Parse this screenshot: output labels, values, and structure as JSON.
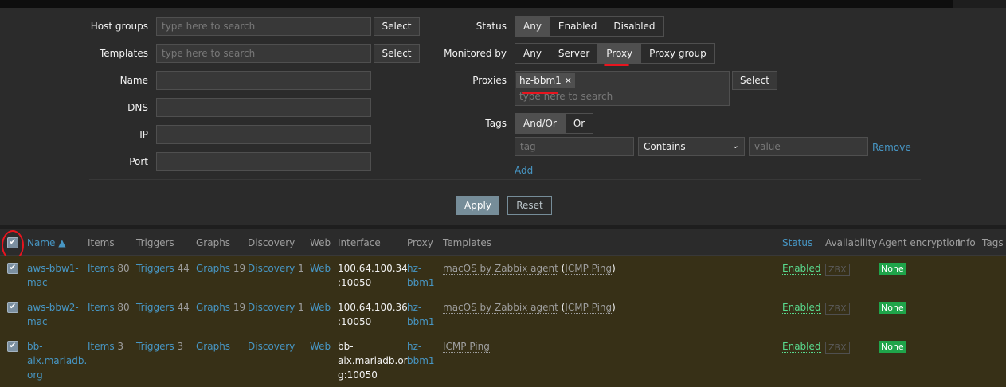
{
  "filter": {
    "host_groups": {
      "label": "Host groups",
      "placeholder": "type here to search",
      "button": "Select"
    },
    "templates": {
      "label": "Templates",
      "placeholder": "type here to search",
      "button": "Select"
    },
    "name": {
      "label": "Name",
      "value": ""
    },
    "dns": {
      "label": "DNS",
      "value": ""
    },
    "ip": {
      "label": "IP",
      "value": ""
    },
    "port": {
      "label": "Port",
      "value": ""
    },
    "status": {
      "label": "Status",
      "options": [
        "Any",
        "Enabled",
        "Disabled"
      ],
      "selected": "Any"
    },
    "monitored_by": {
      "label": "Monitored by",
      "options": [
        "Any",
        "Server",
        "Proxy",
        "Proxy group"
      ],
      "selected": "Proxy"
    },
    "proxies": {
      "label": "Proxies",
      "chip": "hz-bbm1",
      "chip_remove": "✕",
      "placeholder": "type here to search",
      "button": "Select"
    },
    "tags": {
      "label": "Tags",
      "options": [
        "And/Or",
        "Or"
      ],
      "selected": "And/Or",
      "tag_placeholder": "tag",
      "operator": "Contains",
      "value_placeholder": "value",
      "remove": "Remove",
      "add": "Add"
    },
    "apply": "Apply",
    "reset": "Reset"
  },
  "table": {
    "headers": {
      "name": "Name ▲",
      "items": "Items",
      "triggers": "Triggers",
      "graphs": "Graphs",
      "discovery": "Discovery",
      "web": "Web",
      "interface": "Interface",
      "proxy": "Proxy",
      "templates": "Templates",
      "status": "Status",
      "availability": "Availability",
      "encryption": "Agent encryption",
      "info": "Info",
      "tags": "Tags"
    },
    "rows": [
      {
        "name1": "aws-bbw1-",
        "name2": "mac",
        "items": "Items",
        "items_count": "80",
        "triggers": "Triggers",
        "triggers_count": "44",
        "graphs": "Graphs",
        "graphs_count": "19",
        "discovery": "Discovery",
        "discovery_count": "1",
        "web": "Web",
        "iface1": "100.64.100.34",
        "iface2": ":10050",
        "proxy1": "hz-",
        "proxy2": "bbm1",
        "template_main": "macOS by Zabbix agent",
        "template_paren_open": "(",
        "template_sub": "ICMP Ping",
        "template_paren_close": ")",
        "status": "Enabled",
        "availability": "ZBX",
        "encryption": "None"
      },
      {
        "name1": "aws-bbw2-",
        "name2": "mac",
        "items": "Items",
        "items_count": "80",
        "triggers": "Triggers",
        "triggers_count": "44",
        "graphs": "Graphs",
        "graphs_count": "19",
        "discovery": "Discovery",
        "discovery_count": "1",
        "web": "Web",
        "iface1": "100.64.100.36",
        "iface2": ":10050",
        "proxy1": "hz-",
        "proxy2": "bbm1",
        "template_main": "macOS by Zabbix agent",
        "template_paren_open": "(",
        "template_sub": "ICMP Ping",
        "template_paren_close": ")",
        "status": "Enabled",
        "availability": "ZBX",
        "encryption": "None"
      },
      {
        "name1": "bb-",
        "name2": "aix.mariadb.",
        "name3": "org",
        "items": "Items",
        "items_count": "3",
        "triggers": "Triggers",
        "triggers_count": "3",
        "graphs": "Graphs",
        "graphs_count": "",
        "discovery": "Discovery",
        "discovery_count": "",
        "web": "Web",
        "iface1": "bb-",
        "iface2": "aix.mariadb.or",
        "iface3": "g:10050",
        "proxy1": "hz-",
        "proxy2": "bbm1",
        "template_main": "ICMP Ping",
        "status": "Enabled",
        "availability": "ZBX",
        "encryption": "None"
      }
    ]
  },
  "checkbox_mark": "✔"
}
